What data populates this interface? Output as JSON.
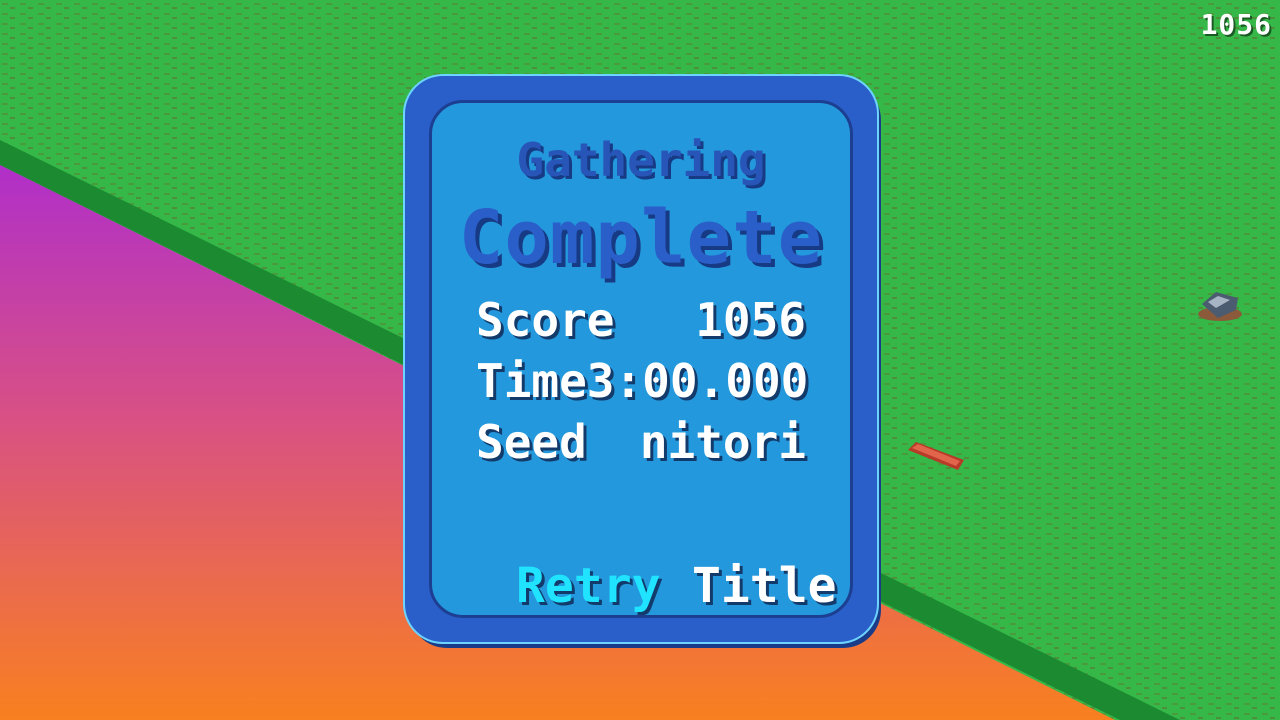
{
  "hud": {
    "score": "1056"
  },
  "dialog": {
    "heading_small": "Gathering",
    "heading_large": "Complete",
    "stats": [
      {
        "label": "Score",
        "value": "1056"
      },
      {
        "label": "Time",
        "value": "3:00.000"
      },
      {
        "label": "Seed",
        "value": "nitori"
      }
    ],
    "buttons": {
      "retry": "Retry",
      "title": "Title"
    }
  },
  "colors": {
    "grass": "#35b848",
    "panel_border": "#2a5ec8",
    "panel_fill": "#2498dc",
    "selected_button": "#20e4ff"
  }
}
